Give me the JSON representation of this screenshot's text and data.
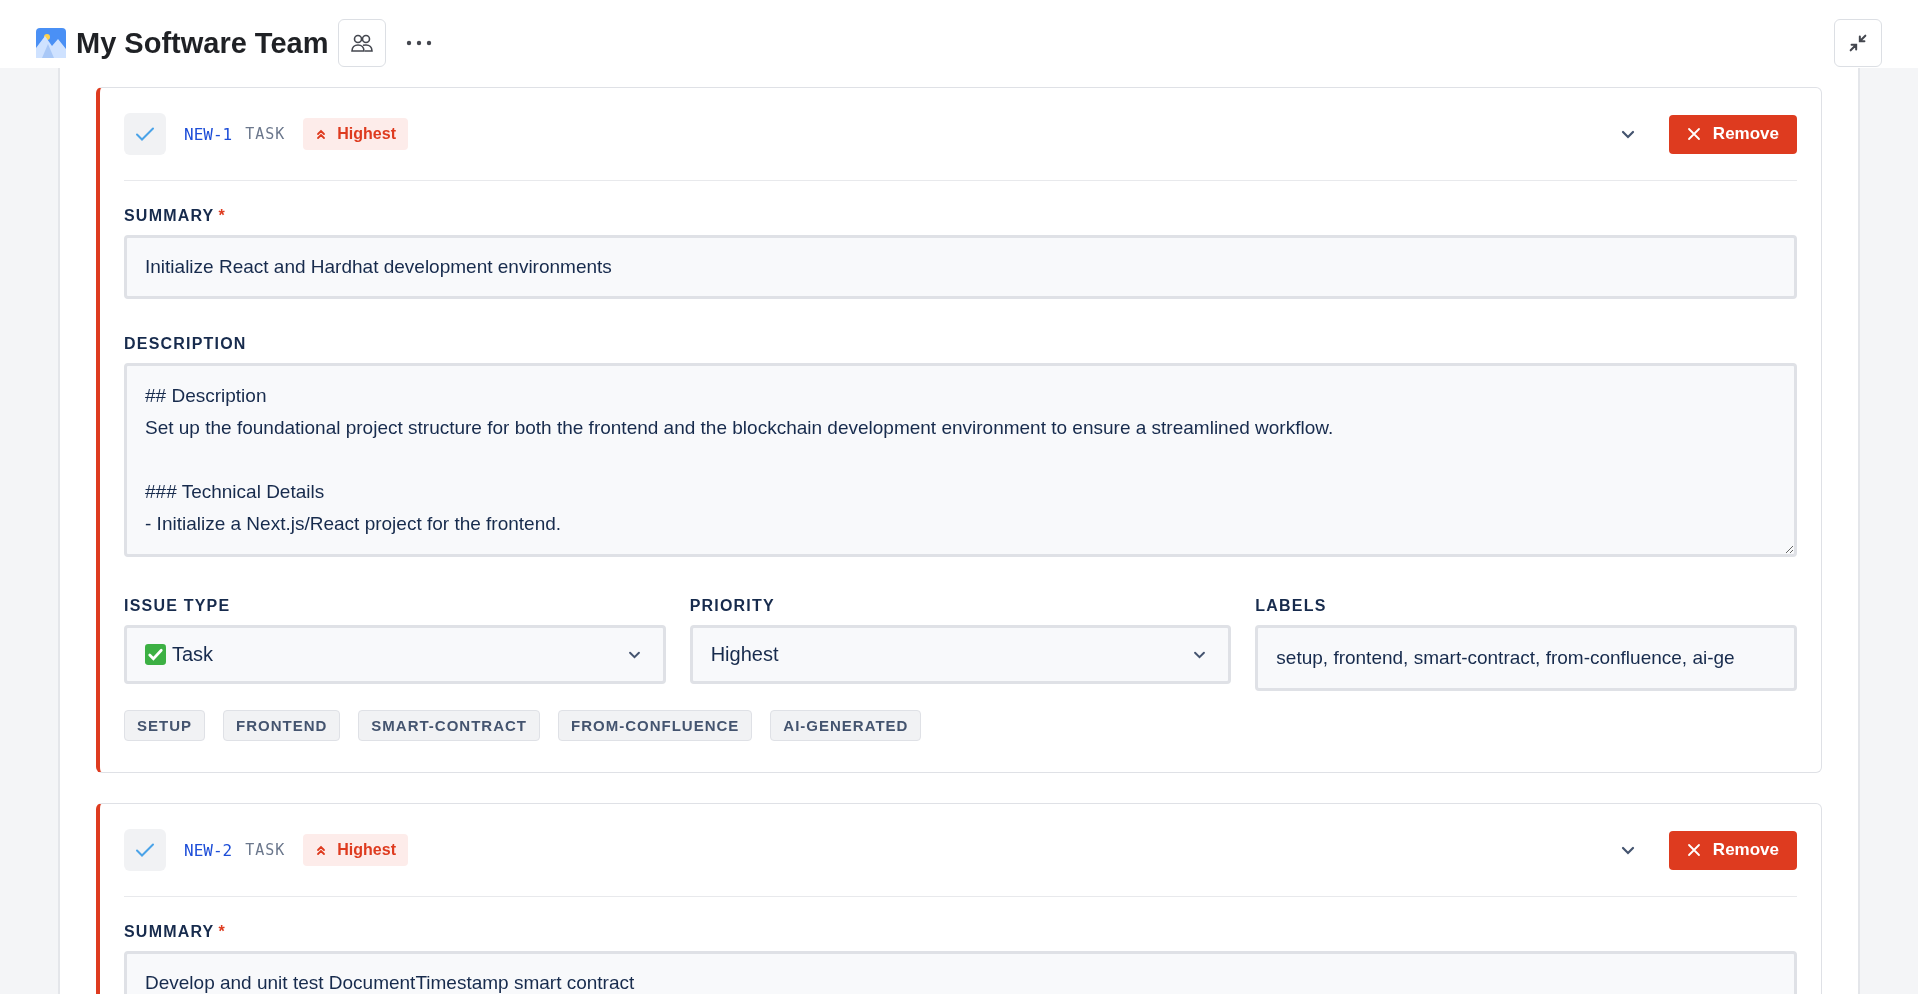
{
  "header": {
    "title": "My Software Team"
  },
  "tasks": [
    {
      "key": "NEW-1",
      "type": "TASK",
      "priority": "Highest",
      "checked": true,
      "expanded": false,
      "remove": "Remove",
      "summary_label": "SUMMARY",
      "required": "*",
      "summary": "Initialize React and Hardhat development environments",
      "description_label": "DESCRIPTION",
      "description": "## Description\nSet up the foundational project structure for both the frontend and the blockchain development environment to ensure a streamlined workflow.\n\n### Technical Details\n- Initialize a Next.js/React project for the frontend.",
      "issue_type_label": "ISSUE TYPE",
      "issue_type": "Task",
      "priority_label": "PRIORITY",
      "priority_value": "Highest",
      "labels_label": "LABELS",
      "labels_value": "setup, frontend, smart-contract, from-confluence, ai-ge",
      "tags": [
        "SETUP",
        "FRONTEND",
        "SMART-CONTRACT",
        "FROM-CONFLUENCE",
        "AI-GENERATED"
      ]
    },
    {
      "key": "NEW-2",
      "type": "TASK",
      "priority": "Highest",
      "checked": true,
      "expanded": false,
      "remove": "Remove",
      "summary_label": "SUMMARY",
      "required": "*",
      "summary": "Develop and unit test DocumentTimestamp smart contract"
    }
  ]
}
